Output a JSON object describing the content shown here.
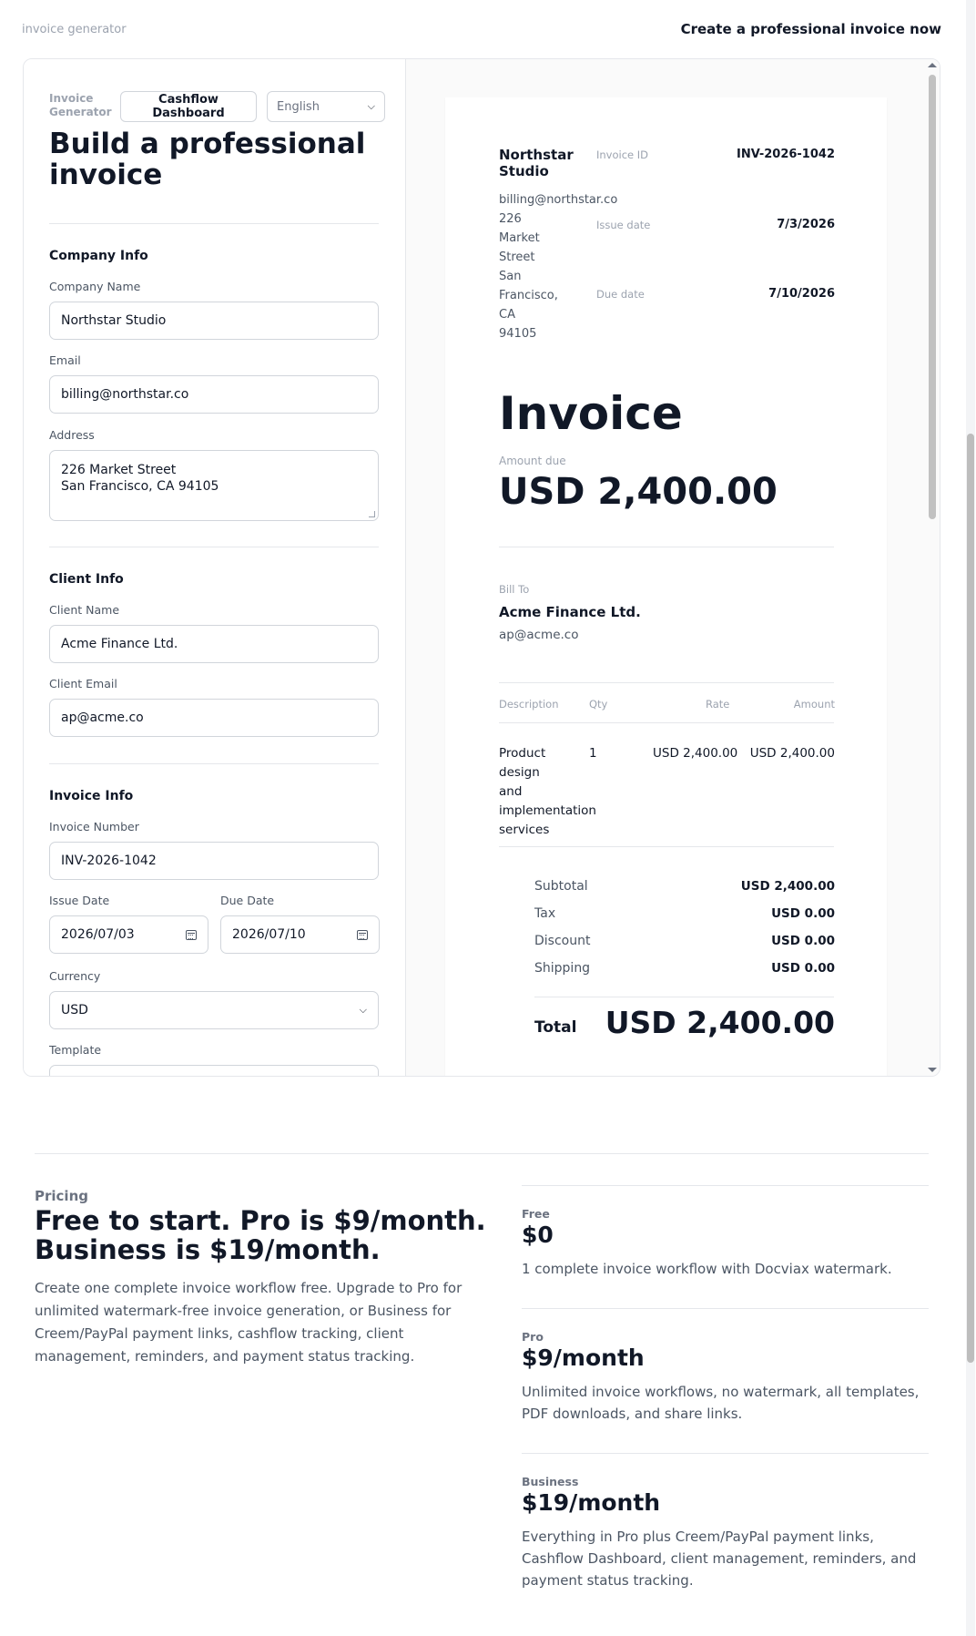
{
  "header": {
    "brand": "invoice generator",
    "cta": "Create a professional invoice now"
  },
  "form": {
    "brand": "Invoice Generator",
    "dashboard_button": "Cashflow Dashboard",
    "language": "English",
    "title": "Build a professional invoice",
    "company_section": "Company Info",
    "company_name_label": "Company Name",
    "company_name": "Northstar Studio",
    "email_label": "Email",
    "email": "billing@northstar.co",
    "address_label": "Address",
    "address_line1": "226 Market Street",
    "address_line2": "San Francisco, CA 94105",
    "client_section": "Client Info",
    "client_name_label": "Client Name",
    "client_name": "Acme Finance Ltd.",
    "client_email_label": "Client Email",
    "client_email": "ap@acme.co",
    "invoice_section": "Invoice Info",
    "invoice_number_label": "Invoice Number",
    "invoice_number": "INV-2026-1042",
    "issue_date_label": "Issue Date",
    "issue_date": "2026/07/03",
    "due_date_label": "Due Date",
    "due_date": "2026/07/10",
    "currency_label": "Currency",
    "currency": "USD",
    "template_label": "Template"
  },
  "preview": {
    "company_name": "Northstar Studio",
    "company_email": "billing@northstar.co",
    "company_address_lines": [
      "226",
      "Market",
      "Street",
      "San",
      "Francisco,",
      "CA",
      "94105"
    ],
    "invoice_id_label": "Invoice ID",
    "invoice_id": "INV-2026-1042",
    "issue_date_label": "Issue date",
    "issue_date": "7/3/2026",
    "due_date_label": "Due date",
    "due_date": "7/10/2026",
    "heading": "Invoice",
    "amount_due_label": "Amount due",
    "amount_due": "USD 2,400.00",
    "bill_to_label": "Bill To",
    "client_name": "Acme Finance Ltd.",
    "client_email": "ap@acme.co",
    "table": {
      "headers": {
        "description": "Description",
        "qty": "Qty",
        "rate": "Rate",
        "amount": "Amount"
      },
      "rows": [
        {
          "description_lines": [
            "Product design",
            "and",
            "implementation",
            "services"
          ],
          "qty": "1",
          "rate": "USD 2,400.00",
          "amount": "USD 2,400.00"
        }
      ]
    },
    "totals": {
      "subtotal_label": "Subtotal",
      "subtotal": "USD 2,400.00",
      "tax_label": "Tax",
      "tax": "USD 0.00",
      "discount_label": "Discount",
      "discount": "USD 0.00",
      "shipping_label": "Shipping",
      "shipping": "USD 0.00",
      "total_label": "Total",
      "total": "USD 2,400.00"
    }
  },
  "pricing": {
    "eyebrow": "Pricing",
    "title_line1": "Free to start. Pro is $9/month.",
    "title_line2": "Business is $19/month.",
    "description": "Create one complete invoice workflow free. Upgrade to Pro for unlimited watermark-free invoice generation, or Business for Creem/PayPal payment links, cashflow tracking, client management, reminders, and payment status tracking.",
    "plans": [
      {
        "name": "Free",
        "price": "$0",
        "description": "1 complete invoice workflow with Docviax watermark."
      },
      {
        "name": "Pro",
        "price": "$9/month",
        "description": "Unlimited invoice workflows, no watermark, all templates, PDF downloads, and share links."
      },
      {
        "name": "Business",
        "price": "$19/month",
        "description": "Everything in Pro plus Creem/PayPal payment links, Cashflow Dashboard, client management, reminders, and payment status tracking."
      }
    ]
  }
}
